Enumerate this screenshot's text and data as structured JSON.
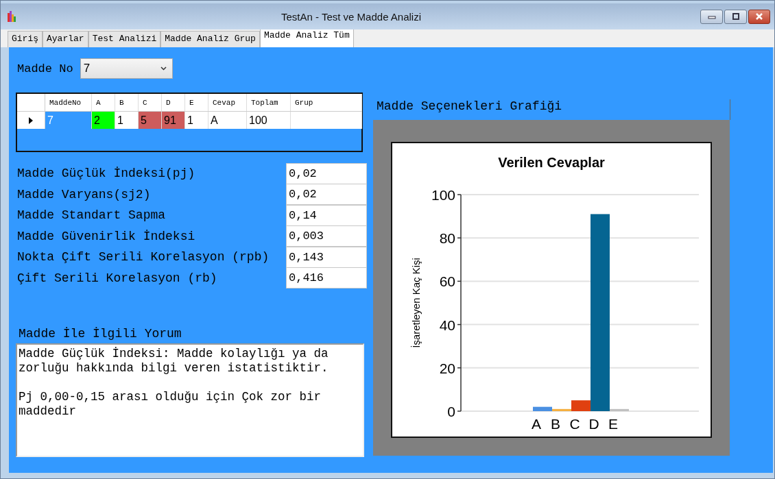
{
  "window": {
    "title": "TestAn - Test ve Madde Analizi"
  },
  "tabs": [
    {
      "label": "Giriş",
      "selected": false
    },
    {
      "label": "Ayarlar",
      "selected": false
    },
    {
      "label": "Test Analizi",
      "selected": false
    },
    {
      "label": "Madde Analiz Grup",
      "selected": false
    },
    {
      "label": "Madde Analiz Tüm",
      "selected": true
    }
  ],
  "item_select": {
    "label": "Madde No",
    "value": "7"
  },
  "table": {
    "columns": [
      "MaddeNo",
      "A",
      "B",
      "C",
      "D",
      "E",
      "Cevap",
      "Toplam",
      "Grup"
    ],
    "rows": [
      {
        "selected": true,
        "cells": [
          {
            "text": "7",
            "color": "#3399ff"
          },
          {
            "text": "2",
            "color": "#00ff00"
          },
          {
            "text": "1",
            "color": "#ffffff"
          },
          {
            "text": "5",
            "color": "#cd5c5c"
          },
          {
            "text": "91",
            "color": "#cd5c5c"
          },
          {
            "text": "1",
            "color": "#ffffff"
          },
          {
            "text": "A",
            "color": "#ffffff"
          },
          {
            "text": "100",
            "color": "#ffffff"
          },
          {
            "text": "",
            "color": "#ffffff"
          }
        ]
      }
    ]
  },
  "stats": [
    {
      "label": "Madde Güçlük İndeksi(pj)",
      "value": "0,02"
    },
    {
      "label": "Madde Varyans(sj2)",
      "value": "0,02"
    },
    {
      "label": "Madde Standart Sapma",
      "value": "0,14"
    },
    {
      "label": "Madde Güvenirlik İndeksi",
      "value": "0,003"
    },
    {
      "label": "Nokta Çift Serili Korelasyon (rpb)",
      "value": "0,143"
    },
    {
      "label": "Çift Serili Korelasyon (rb)",
      "value": "0,416"
    }
  ],
  "comment": {
    "label": "Madde İle İlgili Yorum",
    "paragraphs": [
      "Madde Güçlük İndeksi: Madde kolaylığı ya da zorluğu hakkında bilgi veren istatistiktir.",
      "Pj 0,00-0,15 arası olduğu için Çok zor bir maddedir"
    ]
  },
  "chart_group": {
    "title": "Madde Seçenekleri Grafiği",
    "chart_data": {
      "type": "bar",
      "title": "Verilen Cevaplar",
      "ylabel": "İşaretleyen Kaç Kişi",
      "ylim": [
        0,
        100
      ],
      "yticks": [
        0,
        20,
        40,
        60,
        80,
        100
      ],
      "grid": true,
      "series": [
        {
          "name": "A",
          "color": "#4a90e2",
          "values": [
            2
          ]
        },
        {
          "name": "B",
          "color": "#f5b041",
          "values": [
            1
          ]
        },
        {
          "name": "C",
          "color": "#e04010",
          "values": [
            5
          ]
        },
        {
          "name": "D",
          "color": "#056592",
          "values": [
            91
          ]
        },
        {
          "name": "E",
          "color": "#c0c0c0",
          "values": [
            1
          ]
        }
      ]
    }
  }
}
